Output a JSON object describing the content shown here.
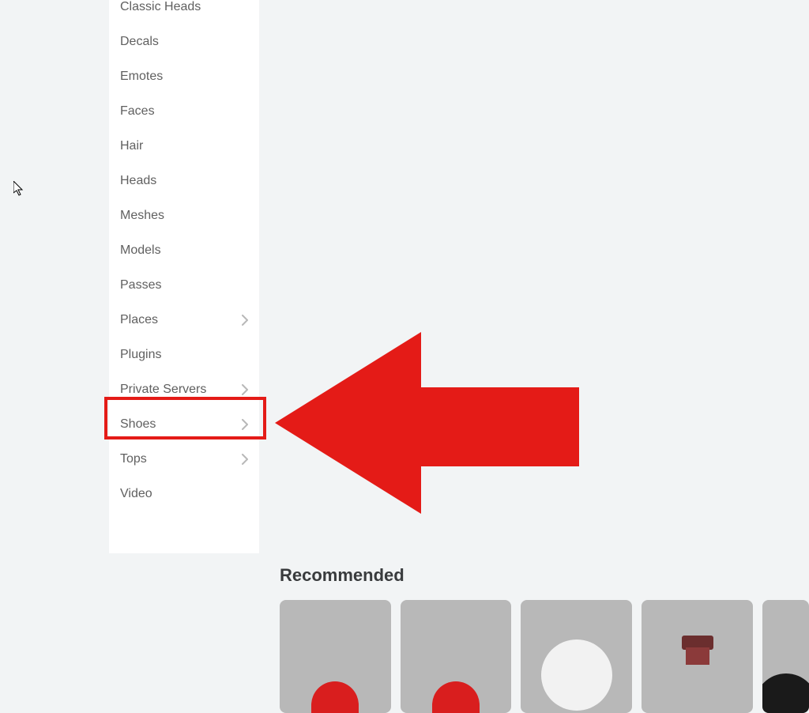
{
  "sidebar": {
    "items": [
      {
        "label": "Classic Heads",
        "hasChevron": false
      },
      {
        "label": "Decals",
        "hasChevron": false
      },
      {
        "label": "Emotes",
        "hasChevron": false
      },
      {
        "label": "Faces",
        "hasChevron": false
      },
      {
        "label": "Hair",
        "hasChevron": false
      },
      {
        "label": "Heads",
        "hasChevron": false
      },
      {
        "label": "Meshes",
        "hasChevron": false
      },
      {
        "label": "Models",
        "hasChevron": false
      },
      {
        "label": "Passes",
        "hasChevron": false
      },
      {
        "label": "Places",
        "hasChevron": true
      },
      {
        "label": "Plugins",
        "hasChevron": false
      },
      {
        "label": "Private Servers",
        "hasChevron": true
      },
      {
        "label": "Shoes",
        "hasChevron": true
      },
      {
        "label": "Tops",
        "hasChevron": true
      },
      {
        "label": "Video",
        "hasChevron": false
      }
    ]
  },
  "recommended": {
    "title": "Recommended"
  }
}
